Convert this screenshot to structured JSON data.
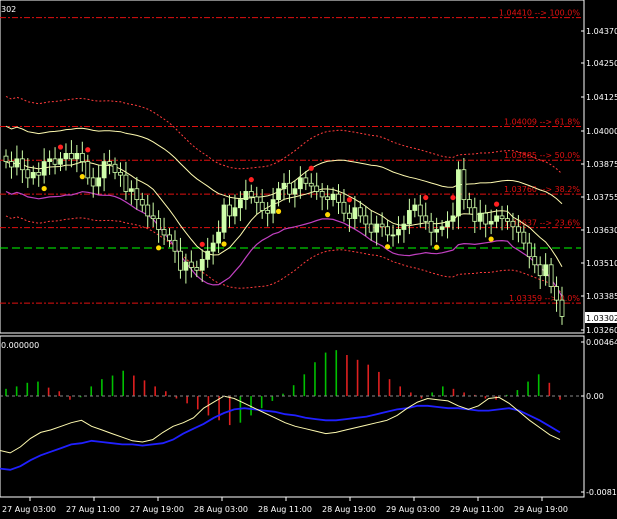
{
  "header": {
    "symbol_fragment": "302",
    "indicator_value": "0.000000"
  },
  "price_axis": {
    "ticks": [
      "1.04370",
      "1.04250",
      "1.04125",
      "1.04000",
      "1.03875",
      "1.03755",
      "1.03630",
      "1.03510",
      "1.03385",
      "1.03260"
    ],
    "current_price": "1.03302"
  },
  "indicator_axis": {
    "ticks": [
      "0.00464",
      "0.00",
      "-0.0081"
    ]
  },
  "time_axis": {
    "ticks": [
      "27 Aug 03:00",
      "27 Aug 11:00",
      "27 Aug 19:00",
      "28 Aug 03:00",
      "28 Aug 11:00",
      "28 Aug 19:00",
      "29 Aug 03:00",
      "29 Aug 11:00",
      "29 Aug 19:00"
    ]
  },
  "fib_levels": [
    {
      "label": "1.04410 --> 100.0%",
      "price": 1.0441
    },
    {
      "label": "1.04009 --> 61.8%",
      "price": 1.04009
    },
    {
      "label": "1.03885 --> 50.0%",
      "price": 1.03885
    },
    {
      "label": "1.03760 --> 38.2%",
      "price": 1.0376
    },
    {
      "label": "1.03637 --> 23.6%",
      "price": 1.03637
    },
    {
      "label": "1.03359 --> 0.0%",
      "price": 1.03359
    }
  ],
  "colors": {
    "background": "#000000",
    "grid": "#ffffff",
    "bull_candle": "#cfffaa",
    "bear_candle": "#000000",
    "bollinger_mid": "#fffbb0",
    "bollinger_outer": "#ff3b3b",
    "envelope": "#ff3b3b",
    "lower_line": "#c040c0",
    "fractal_up": "#ff2020",
    "fractal_down": "#ffd800",
    "hist_up": "#00c000",
    "hist_down": "#e02020",
    "signal_line": "#fffbb0",
    "main_line": "#2020ff",
    "fib": "#e01010",
    "green_dash": "#00ff00"
  },
  "chart_data": {
    "type": "candlestick",
    "price_range": [
      1.0326,
      1.0446
    ],
    "indicator_range": [
      -0.0081,
      0.00464
    ],
    "closes": [
      1.0388,
      1.0386,
      1.0389,
      1.0385,
      1.0382,
      1.0384,
      1.0383,
      1.0388,
      1.0389,
      1.0387,
      1.0389,
      1.0391,
      1.0389,
      1.0391,
      1.0388,
      1.0382,
      1.0379,
      1.0382,
      1.0388,
      1.0387,
      1.0384,
      1.0383,
      1.0377,
      1.0378,
      1.0374,
      1.0372,
      1.0368,
      1.0367,
      1.0363,
      1.0361,
      1.0359,
      1.0355,
      1.0348,
      1.0351,
      1.0349,
      1.0348,
      1.0352,
      1.0355,
      1.0358,
      1.0362,
      1.0372,
      1.0368,
      1.0371,
      1.0374,
      1.0377,
      1.0375,
      1.0373,
      1.037,
      1.0369,
      1.0374,
      1.0378,
      1.038,
      1.0376,
      1.0378,
      1.0382,
      1.038,
      1.0379,
      1.0377,
      1.0375,
      1.0374,
      1.0376,
      1.0373,
      1.0369,
      1.0367,
      1.0371,
      1.0368,
      1.0365,
      1.0362,
      1.0365,
      1.0364,
      1.0361,
      1.0361,
      1.0363,
      1.0365,
      1.037,
      1.0372,
      1.0368,
      1.0366,
      1.0362,
      1.0363,
      1.0364,
      1.0366,
      1.0368,
      1.0385,
      1.0374,
      1.0371,
      1.0366,
      1.0369,
      1.0365,
      1.0366,
      1.0368,
      1.0367,
      1.0366,
      1.0364,
      1.0362,
      1.0358,
      1.0353,
      1.035,
      1.0346,
      1.035,
      1.0342,
      1.0337,
      1.0331
    ],
    "histogram": [
      0.0006,
      0.0008,
      0.0011,
      0.0012,
      0.0007,
      0.0004,
      -0.0003,
      -0.0001,
      0.0008,
      0.0014,
      0.0017,
      0.0021,
      0.0017,
      0.0013,
      0.0008,
      0.0004,
      -0.0002,
      -0.0006,
      -0.0011,
      -0.0016,
      -0.002,
      -0.0024,
      -0.0022,
      -0.0016,
      -0.001,
      -0.0004,
      0.0002,
      0.0009,
      0.0018,
      0.0028,
      0.0036,
      0.0038,
      0.0034,
      0.003,
      0.0026,
      0.002,
      0.0014,
      0.0008,
      0.0003,
      -0.0002,
      0.0003,
      0.0008,
      0.0006,
      0.0003,
      0.0001,
      -0.0002,
      -0.0003,
      0.0001,
      0.0005,
      0.0012,
      0.0018,
      0.0011,
      -0.0003
    ],
    "signal_line": [
      -0.0045,
      -0.0047,
      -0.0042,
      -0.0035,
      -0.003,
      -0.0028,
      -0.0025,
      -0.0022,
      -0.002,
      -0.0025,
      -0.0028,
      -0.0031,
      -0.0034,
      -0.0037,
      -0.0038,
      -0.0036,
      -0.003,
      -0.0025,
      -0.0022,
      -0.0018,
      -0.001,
      -0.0005,
      0.0,
      -0.0002,
      -0.0006,
      -0.001,
      -0.0014,
      -0.0018,
      -0.0022,
      -0.0025,
      -0.0027,
      -0.0029,
      -0.0031,
      -0.003,
      -0.0028,
      -0.0026,
      -0.0024,
      -0.0022,
      -0.002,
      -0.0016,
      -0.001,
      -0.0005,
      -0.0002,
      -0.0003,
      -0.0004,
      -0.0008,
      -0.0011,
      -0.0008,
      -0.0002,
      -0.0001,
      -0.0006,
      -0.0013,
      -0.002,
      -0.0026,
      -0.0032,
      -0.0036
    ],
    "main_line": [
      -0.006,
      -0.0061,
      -0.0058,
      -0.0053,
      -0.0049,
      -0.0046,
      -0.0043,
      -0.004,
      -0.0039,
      -0.0037,
      -0.0038,
      -0.0039,
      -0.004,
      -0.004,
      -0.0041,
      -0.004,
      -0.0039,
      -0.0036,
      -0.0031,
      -0.0027,
      -0.0023,
      -0.0018,
      -0.0014,
      -0.0011,
      -0.001,
      -0.0011,
      -0.0012,
      -0.0013,
      -0.0015,
      -0.0016,
      -0.0018,
      -0.0019,
      -0.002,
      -0.002,
      -0.0019,
      -0.0018,
      -0.0017,
      -0.0015,
      -0.0013,
      -0.0011,
      -0.001,
      -0.0008,
      -0.0008,
      -0.0009,
      -0.001,
      -0.001,
      -0.0011,
      -0.0012,
      -0.0012,
      -0.0011,
      -0.001,
      -0.0012,
      -0.0016,
      -0.002,
      -0.0025,
      -0.003
    ]
  }
}
